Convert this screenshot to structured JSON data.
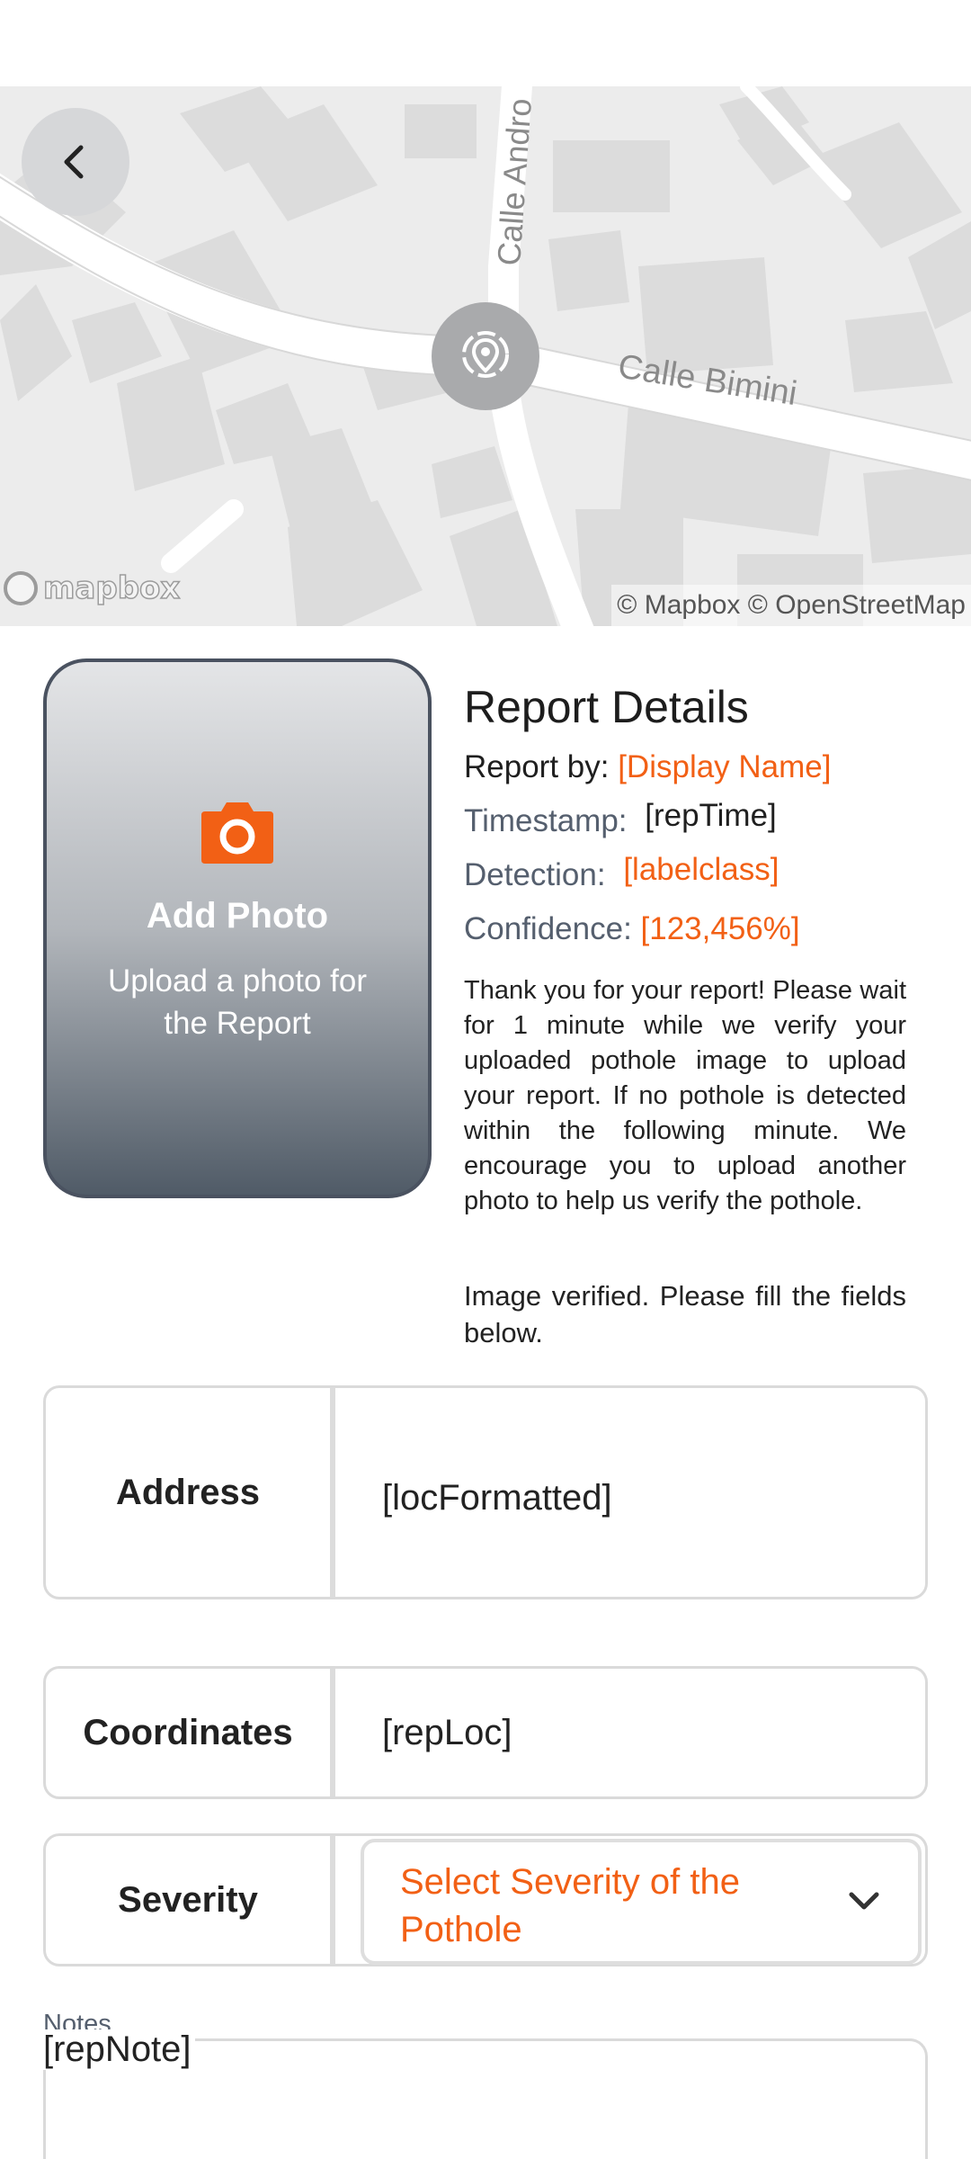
{
  "map": {
    "street_1": "Calle Andro",
    "street_2": "Calle Bimini",
    "logo_text": "mapbox",
    "attribution": "© Mapbox © OpenStreetMap"
  },
  "photo": {
    "title": "Add Photo",
    "subtitle": "Upload a photo for the Report",
    "icon": "camera-icon",
    "accent": "#f26015"
  },
  "details": {
    "heading": "Report Details",
    "report_by_label": "Report by:",
    "report_by_value": "[Display Name]",
    "timestamp_label": "Timestamp:",
    "timestamp_value": "[repTime]",
    "detection_label": "Detection:",
    "detection_value": "[labelclass]",
    "confidence_label": "Confidence:",
    "confidence_value": "[123,456%]",
    "message": "Thank you for your report! Please wait for 1 minute while we verify your uploaded pothole image to upload your report. If no pothole is detected within the following minute. We encourage you to upload another photo to help us verify the pothole.",
    "verified": "Image verified. Please fill the fields below."
  },
  "form": {
    "address_label": "Address",
    "address_value": "[locFormatted]",
    "coordinates_label": "Coordinates",
    "coordinates_value": "[repLoc]",
    "severity_label": "Severity",
    "severity_placeholder": "Select Severity of the Pothole",
    "notes_label": "Notes",
    "notes_value": "[repNote]"
  }
}
